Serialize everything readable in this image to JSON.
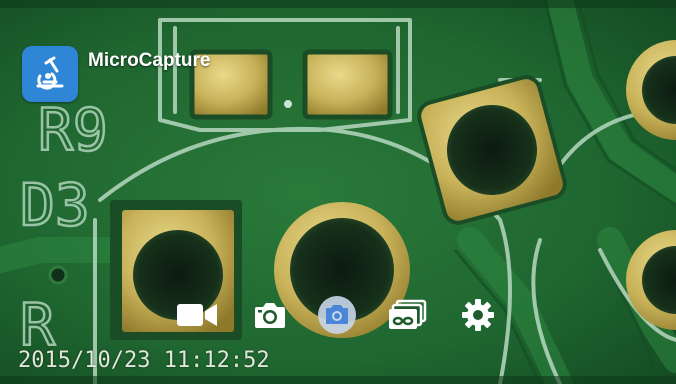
{
  "app": {
    "title": "MicroCapture",
    "icon": "microscope-icon",
    "accent_color": "#2f86d6"
  },
  "overlay": {
    "timestamp": "2015/10/23  11:12:52"
  },
  "pcb_labels": {
    "r9": "R9",
    "d3": "D3",
    "r": "R"
  },
  "toolbar": {
    "items": [
      {
        "name": "video-record",
        "icon": "video-camera-icon"
      },
      {
        "name": "photo-mode",
        "icon": "camera-icon"
      },
      {
        "name": "capture",
        "icon": "camera-shutter-icon"
      },
      {
        "name": "gallery",
        "icon": "gallery-stack-icon"
      },
      {
        "name": "settings",
        "icon": "gear-icon"
      }
    ]
  }
}
